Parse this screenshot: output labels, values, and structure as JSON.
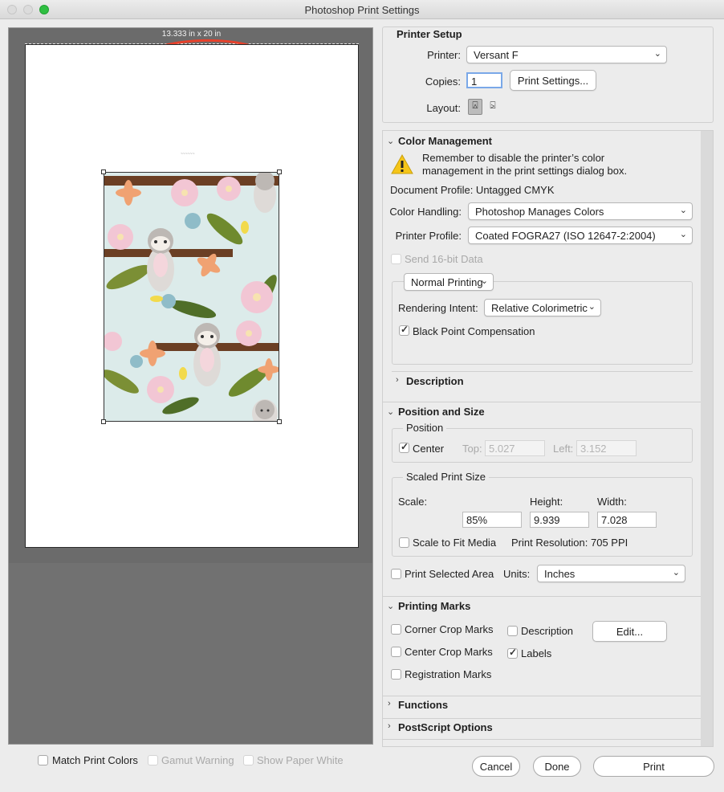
{
  "window": {
    "title": "Photoshop Print Settings"
  },
  "preview": {
    "size_label": "13.333 in x 20 in",
    "tiny_label": "~~~~~~",
    "match_print_colors": "Match Print Colors",
    "gamut_warning": "Gamut Warning",
    "show_paper_white": "Show Paper White",
    "annotation_color": "#e8412b"
  },
  "printer_setup": {
    "title": "Printer Setup",
    "printer_label": "Printer:",
    "printer_value": "Versant F",
    "copies_label": "Copies:",
    "copies_value": "1",
    "print_settings_button": "Print Settings...",
    "layout_label": "Layout:"
  },
  "color_management": {
    "title": "Color Management",
    "warning": "Remember to disable the printer’s color management in the print settings dialog box.",
    "document_profile": "Document Profile: Untagged CMYK",
    "color_handling_label": "Color Handling:",
    "color_handling_value": "Photoshop Manages Colors",
    "printer_profile_label": "Printer Profile:",
    "printer_profile_value": "Coated FOGRA27 (ISO 12647-2:2004)",
    "send_16bit": "Send 16-bit Data",
    "normal_printing": "Normal Printing",
    "rendering_intent_label": "Rendering Intent:",
    "rendering_intent_value": "Relative Colorimetric",
    "black_point": "Black Point Compensation"
  },
  "description_section": {
    "title": "Description"
  },
  "position_size": {
    "title": "Position and Size",
    "position_legend": "Position",
    "center": "Center",
    "top_label": "Top:",
    "top_value": "5.027",
    "left_label": "Left:",
    "left_value": "3.152",
    "scaled_legend": "Scaled Print Size",
    "scale_label": "Scale:",
    "height_label": "Height:",
    "width_label": "Width:",
    "scale_value": "85%",
    "height_value": "9.939",
    "width_value": "7.028",
    "scale_to_fit": "Scale to Fit Media",
    "print_resolution": "Print Resolution: 705 PPI",
    "print_selected_area": "Print Selected Area",
    "units_label": "Units:",
    "units_value": "Inches"
  },
  "printing_marks": {
    "title": "Printing Marks",
    "corner_crop": "Corner Crop Marks",
    "center_crop": "Center Crop Marks",
    "registration": "Registration Marks",
    "description": "Description",
    "labels": "Labels",
    "edit_button": "Edit..."
  },
  "functions_section": {
    "title": "Functions"
  },
  "postscript_section": {
    "title": "PostScript Options"
  },
  "footer": {
    "cancel": "Cancel",
    "done": "Done",
    "print": "Print"
  }
}
